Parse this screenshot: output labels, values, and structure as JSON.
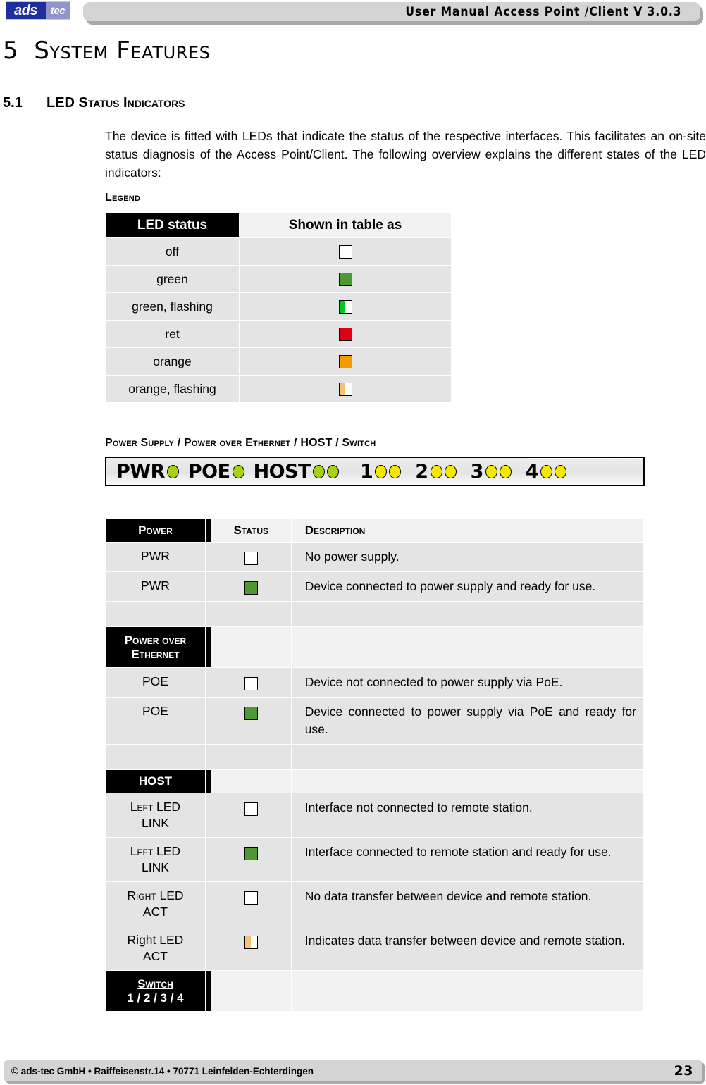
{
  "header": {
    "logo_primary": "ads",
    "logo_secondary": "tec",
    "title": "User Manual Access  Point /Client V 3.0.3"
  },
  "chapter": {
    "number": "5",
    "title": "System Features"
  },
  "section": {
    "number": "5.1",
    "title": "LED Status Indicators",
    "body": "The device is fitted with LEDs that indicate the status of the respective interfaces. This facilitates an on-site status diagnosis of the Access Point/Client. The following overview explains the different states of the LED indicators:"
  },
  "legend": {
    "label": "Legend",
    "columns": [
      "LED status",
      "Shown in table as"
    ],
    "rows": [
      {
        "status": "off",
        "swatch": "off-swatch",
        "color": "#ffffff",
        "split": false
      },
      {
        "status": "green",
        "swatch": "green-swatch",
        "color": "#4e9a32",
        "split": false
      },
      {
        "status": "green, flashing",
        "swatch": "green-flashing-swatch",
        "color": "#00c81e",
        "split": true
      },
      {
        "status": "ret",
        "swatch": "red-swatch",
        "color": "#e00018",
        "split": false
      },
      {
        "status": "orange",
        "swatch": "orange-swatch",
        "color": "#f79a00",
        "split": false
      },
      {
        "status": "orange, flashing",
        "swatch": "orange-flashing-swatch",
        "color": "#f5c271",
        "split": true
      }
    ]
  },
  "panel": {
    "label": "Power Supply / Power over Ethernet / HOST / Switch",
    "groups": [
      {
        "text": "PWR",
        "leds": 1,
        "color": "#a6d117"
      },
      {
        "text": "POE",
        "leds": 1,
        "color": "#a6d117"
      },
      {
        "text": "HOST",
        "leds": 2,
        "color": "#a6d117"
      },
      {
        "text": "1",
        "leds": 2,
        "color": "#f5e800"
      },
      {
        "text": "2",
        "leds": 2,
        "color": "#f5e800"
      },
      {
        "text": "3",
        "leds": 2,
        "color": "#f5e800"
      },
      {
        "text": "4",
        "leds": 2,
        "color": "#f5e800"
      }
    ]
  },
  "table": {
    "headers": {
      "power": "Power",
      "status": "Status",
      "description": "Description",
      "power_over_ethernet_l1": "Power over",
      "power_over_ethernet_l2": "Ethernet",
      "host": "HOST",
      "switch_l1": "Switch",
      "switch_l2": "1 / 2 / 3 / 4"
    },
    "power_rows": [
      {
        "label": "PWR",
        "swatch_color": "#ffffff",
        "split": false,
        "description": "No power supply."
      },
      {
        "label": "PWR",
        "swatch_color": "#4e9a32",
        "split": false,
        "description": "Device connected to power supply and ready for use."
      }
    ],
    "poe_rows": [
      {
        "label": "POE",
        "swatch_color": "#ffffff",
        "split": false,
        "description": "Device not connected to power supply via PoE."
      },
      {
        "label": "POE",
        "swatch_color": "#4e9a32",
        "split": false,
        "description": "Device connected to power supply via PoE and ready for use."
      }
    ],
    "host_rows": [
      {
        "label_line1": "Left LED",
        "label_line2": "LINK",
        "smallcaps": true,
        "swatch_color": "#ffffff",
        "split": false,
        "description": "Interface not connected to remote station."
      },
      {
        "label_line1": "Left LED",
        "label_line2": "LINK",
        "smallcaps": true,
        "swatch_color": "#4e9a32",
        "split": false,
        "description": "Interface connected to remote station and ready for use."
      },
      {
        "label_line1": "Right LED",
        "label_line2": "ACT",
        "smallcaps": true,
        "swatch_color": "#ffffff",
        "split": false,
        "description": "No data transfer between device and remote station."
      },
      {
        "label_line1": "Right LED",
        "label_line2": "ACT",
        "smallcaps": false,
        "swatch_color": "#f5c271",
        "split": true,
        "description": "Indicates data transfer between device and remote station."
      }
    ]
  },
  "footer": {
    "text": "© ads-tec GmbH • Raiffeisenstr.14 • 70771 Leinfelden-Echterdingen",
    "page": "23"
  }
}
